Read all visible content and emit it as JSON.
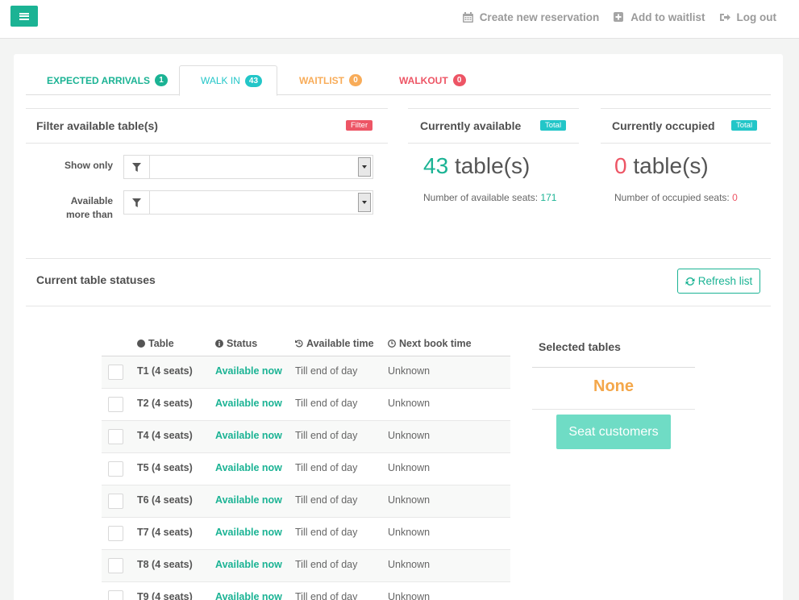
{
  "topbar": {
    "links": [
      {
        "label": "Create new reservation",
        "icon": "calendar-icon"
      },
      {
        "label": "Add to waitlist",
        "icon": "plus-square-icon"
      },
      {
        "label": "Log out",
        "icon": "sign-out-icon"
      }
    ]
  },
  "tabs": [
    {
      "label": "EXPECTED ARRIVALS",
      "count": "1",
      "color": "#1bb394",
      "badge_color": "#1bb394"
    },
    {
      "label": "WALK IN",
      "count": "43",
      "color": "#23c6c8",
      "badge_color": "#23c6c8"
    },
    {
      "label": "WAITLIST",
      "count": "0",
      "color": "#f8ac59",
      "badge_color": "#f8ac59"
    },
    {
      "label": "WALKOUT",
      "count": "0",
      "color": "#ed5565",
      "badge_color": "#ed5565"
    }
  ],
  "filter": {
    "title": "Filter available table(s)",
    "tag": "Filter",
    "show_only_label": "Show only",
    "available_more_than_label_1": "Available",
    "available_more_than_label_2": "more than",
    "show_only_value": "",
    "available_more_than_value": ""
  },
  "available": {
    "title": "Currently available",
    "tag": "Total",
    "count": "43",
    "unit": "table(s)",
    "seats_label": "Number of available seats:",
    "seats": "171"
  },
  "occupied": {
    "title": "Currently occupied",
    "tag": "Total",
    "count": "0",
    "unit": "table(s)",
    "seats_label": "Number of occupied seats:",
    "seats": "0"
  },
  "statuses": {
    "title": "Current table statuses",
    "refresh_label": "Refresh list",
    "headers": {
      "table": "Table",
      "status": "Status",
      "available_time": "Available time",
      "next_book_time": "Next book time"
    },
    "rows": [
      {
        "table": "T1 (4 seats)",
        "status": "Available now",
        "available_time": "Till end of day",
        "next_book_time": "Unknown"
      },
      {
        "table": "T2 (4 seats)",
        "status": "Available now",
        "available_time": "Till end of day",
        "next_book_time": "Unknown"
      },
      {
        "table": "T4 (4 seats)",
        "status": "Available now",
        "available_time": "Till end of day",
        "next_book_time": "Unknown"
      },
      {
        "table": "T5 (4 seats)",
        "status": "Available now",
        "available_time": "Till end of day",
        "next_book_time": "Unknown"
      },
      {
        "table": "T6 (4 seats)",
        "status": "Available now",
        "available_time": "Till end of day",
        "next_book_time": "Unknown"
      },
      {
        "table": "T7 (4 seats)",
        "status": "Available now",
        "available_time": "Till end of day",
        "next_book_time": "Unknown"
      },
      {
        "table": "T8 (4 seats)",
        "status": "Available now",
        "available_time": "Till end of day",
        "next_book_time": "Unknown"
      },
      {
        "table": "T9 (4 seats)",
        "status": "Available now",
        "available_time": "Till end of day",
        "next_book_time": "Unknown"
      }
    ]
  },
  "selected": {
    "title": "Selected tables",
    "value": "None",
    "seat_button": "Seat customers"
  }
}
